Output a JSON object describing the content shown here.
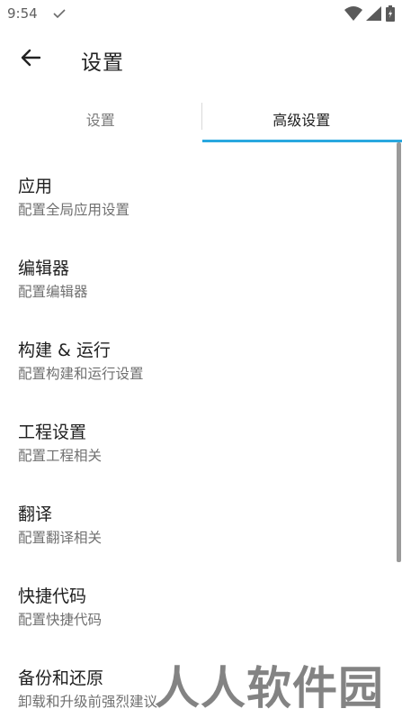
{
  "status_bar": {
    "time": "9:54"
  },
  "header": {
    "title": "设置"
  },
  "tabs": [
    {
      "label": "设置",
      "active": false
    },
    {
      "label": "高级设置",
      "active": true
    }
  ],
  "colors": {
    "accent": "#29a8df"
  },
  "items": [
    {
      "title": "应用",
      "subtitle": "配置全局应用设置"
    },
    {
      "title": "编辑器",
      "subtitle": "配置编辑器"
    },
    {
      "title": "构建 & 运行",
      "subtitle": "配置构建和运行设置"
    },
    {
      "title": "工程设置",
      "subtitle": "配置工程相关"
    },
    {
      "title": "翻译",
      "subtitle": "配置翻译相关"
    },
    {
      "title": "快捷代码",
      "subtitle": "配置快捷代码"
    },
    {
      "title": "备份和还原",
      "subtitle": "卸载和升级前强烈建议"
    }
  ],
  "watermark": "人人软件园"
}
